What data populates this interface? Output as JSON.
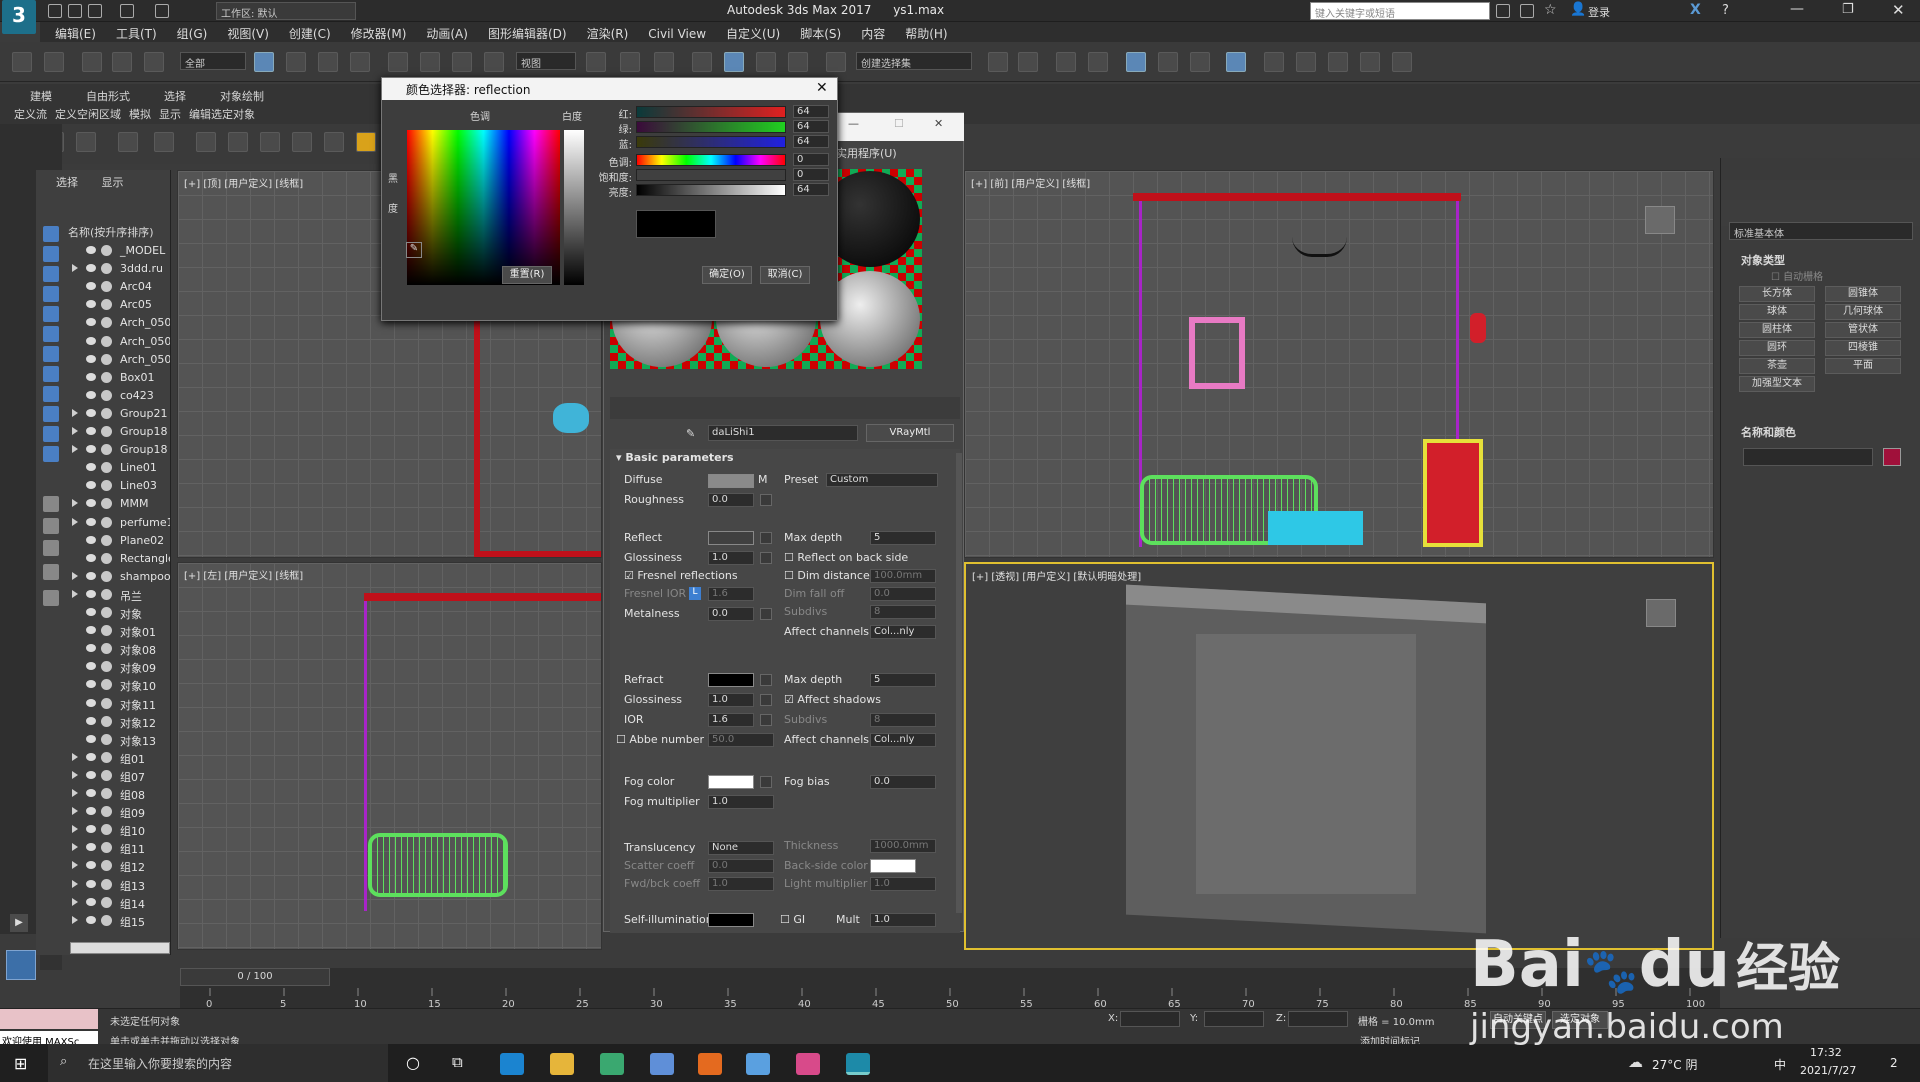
{
  "app": {
    "title": "Autodesk 3ds Max 2017",
    "file": "ys1.max",
    "workspace": "工作区: 默认",
    "search_placeholder": "键入关键字或短语",
    "login": "登录"
  },
  "menu": [
    "编辑(E)",
    "工具(T)",
    "组(G)",
    "视图(V)",
    "创建(C)",
    "修改器(M)",
    "动画(A)",
    "图形编辑器(D)",
    "渲染(R)",
    "Civil View",
    "自定义(U)",
    "脚本(S)",
    "内容",
    "帮助(H)"
  ],
  "toolbar": {
    "filter": "全部",
    "ref_coord": "视图",
    "selection_set": "创建选择集"
  },
  "ribbon": {
    "tabs": [
      "建模",
      "自由形式",
      "选择",
      "对象绘制"
    ],
    "sub": [
      "定义流",
      "定义空闲区域",
      "模拟",
      "显示",
      "编辑选定对象"
    ]
  },
  "scene_explorer": {
    "tabs": [
      "选择",
      "显示"
    ],
    "header": "名称(按升序排序)",
    "items": [
      {
        "name": "_MODEL",
        "exp": false
      },
      {
        "name": "3ddd.ru",
        "exp": true
      },
      {
        "name": "Arc04",
        "exp": false
      },
      {
        "name": "Arc05",
        "exp": false
      },
      {
        "name": "Arch_050",
        "exp": false
      },
      {
        "name": "Arch_050",
        "exp": false
      },
      {
        "name": "Arch_050",
        "exp": false
      },
      {
        "name": "Box01",
        "exp": false
      },
      {
        "name": "co423",
        "exp": false
      },
      {
        "name": "Group21",
        "exp": true
      },
      {
        "name": "Group18",
        "exp": true
      },
      {
        "name": "Group18",
        "exp": true
      },
      {
        "name": "Line01",
        "exp": false
      },
      {
        "name": "Line03",
        "exp": false
      },
      {
        "name": "MMM",
        "exp": true
      },
      {
        "name": "perfume1",
        "exp": true
      },
      {
        "name": "Plane02",
        "exp": false
      },
      {
        "name": "Rectangle",
        "exp": false
      },
      {
        "name": "shampoo",
        "exp": true
      },
      {
        "name": "吊兰",
        "exp": true
      },
      {
        "name": "对象",
        "exp": false
      },
      {
        "name": "对象01",
        "exp": false
      },
      {
        "name": "对象08",
        "exp": false
      },
      {
        "name": "对象09",
        "exp": false
      },
      {
        "name": "对象10",
        "exp": false
      },
      {
        "name": "对象11",
        "exp": false
      },
      {
        "name": "对象12",
        "exp": false
      },
      {
        "name": "对象13",
        "exp": false
      },
      {
        "name": "组01",
        "exp": true
      },
      {
        "name": "组07",
        "exp": true
      },
      {
        "name": "组08",
        "exp": true
      },
      {
        "name": "组09",
        "exp": true
      },
      {
        "name": "组10",
        "exp": true
      },
      {
        "name": "组11",
        "exp": true
      },
      {
        "name": "组12",
        "exp": true
      },
      {
        "name": "组13",
        "exp": true
      },
      {
        "name": "组14",
        "exp": true
      },
      {
        "name": "组15",
        "exp": true
      }
    ]
  },
  "viewports": {
    "top": "[+] [顶] [用户定义] [线框]",
    "front": "[+] [前] [用户定义] [线框]",
    "left": "[+] [左] [用户定义] [线框]",
    "persp": "[+] [透视] [用户定义] [默认明暗处理]"
  },
  "color_picker": {
    "title": "颜色选择器: reflection",
    "hue_label": "色调",
    "white_label": "白度",
    "black_label": "黑",
    "deg_label": "度",
    "rows": [
      {
        "label": "红:",
        "value": "64"
      },
      {
        "label": "绿:",
        "value": "64"
      },
      {
        "label": "蓝:",
        "value": "64"
      },
      {
        "label": "色调:",
        "value": "0"
      },
      {
        "label": "饱和度:",
        "value": "0"
      },
      {
        "label": "亮度:",
        "value": "64"
      }
    ],
    "reset": "重置(R)",
    "ok": "确定(O)",
    "cancel": "取消(C)"
  },
  "material_editor": {
    "util_menu": "实用程序(U)",
    "material_name": "daLiShi1",
    "material_type": "VRayMtl",
    "section": "Basic parameters",
    "diffuse": "Diffuse",
    "diffuse_m": "M",
    "roughness": "Roughness",
    "roughness_val": "0.0",
    "preset": "Preset",
    "preset_val": "Custom",
    "reflect": "Reflect",
    "max_depth": "Max depth",
    "max_depth_val": "5",
    "glossiness": "Glossiness",
    "gloss_val": "1.0",
    "reflect_back": "Reflect on back side",
    "fresnel": "Fresnel reflections",
    "dim_distance": "Dim distance",
    "dim_distance_val": "100.0mm",
    "fresnel_ior": "Fresnel IOR",
    "fresnel_ior_val": "1.6",
    "fresnel_l": "L",
    "dim_falloff": "Dim fall off",
    "dim_falloff_val": "0.0",
    "subdivs": "Subdivs",
    "subdivs_val": "8",
    "metalness": "Metalness",
    "metalness_val": "0.0",
    "affect_channels": "Affect channels",
    "affect_val": "Col...nly",
    "refract": "Refract",
    "refr_max_depth_val": "5",
    "refr_gloss_val": "1.0",
    "affect_shadows": "Affect shadows",
    "ior": "IOR",
    "ior_val": "1.6",
    "refr_subdivs_val": "8",
    "abbe": "Abbe number",
    "abbe_val": "50.0",
    "refr_affect_val": "Col...nly",
    "fog_color": "Fog color",
    "fog_bias": "Fog bias",
    "fog_bias_val": "0.0",
    "fog_mult": "Fog multiplier",
    "fog_mult_val": "1.0",
    "translucency": "Translucency",
    "translucency_val": "None",
    "thickness": "Thickness",
    "thickness_val": "1000.0mm",
    "scatter": "Scatter coeff",
    "scatter_val": "0.0",
    "backside": "Back-side color",
    "fwdbck": "Fwd/bck coeff",
    "fwdbck_val": "1.0",
    "light_mult": "Light multiplier",
    "light_mult_val": "1.0",
    "self_illum": "Self-illumination",
    "gi": "GI",
    "mult": "Mult",
    "mult_val": "1.0"
  },
  "command_panel": {
    "dropdown": "标准基本体",
    "object_type": "对象类型",
    "autogrid": "自动栅格",
    "buttons": [
      "长方体",
      "圆锥体",
      "球体",
      "几何球体",
      "圆柱体",
      "管状体",
      "圆环",
      "四棱锥",
      "茶壶",
      "平面",
      "加强型文本"
    ],
    "name_color": "名称和颜色"
  },
  "timeline": {
    "frame": "0 / 100",
    "ticks": [
      "0",
      "5",
      "10",
      "15",
      "20",
      "25",
      "30",
      "35",
      "40",
      "45",
      "50",
      "55",
      "60",
      "65",
      "70",
      "75",
      "80",
      "85",
      "90",
      "95",
      "100"
    ]
  },
  "status": {
    "welcome": "欢迎使用 MAXSc",
    "none_selected": "未选定任何对象",
    "hint": "单击或单击并拖动以选择对象",
    "x": "X:",
    "y": "Y:",
    "z": "Z:",
    "grid": "栅格 = 10.0mm",
    "auto_key": "自动关键点",
    "selected": "选定对象",
    "add_time_tag": "添加时间标记"
  },
  "taskbar": {
    "search": "在这里输入你要搜索的内容",
    "weather": "27°C 阴",
    "ime": "中",
    "time": "17:32",
    "date": "2021/7/27",
    "notify": "2"
  },
  "watermark": {
    "logo": "Bai",
    "logo2": "du",
    "cn": "经验",
    "url": "jingyan.baidu.com"
  }
}
